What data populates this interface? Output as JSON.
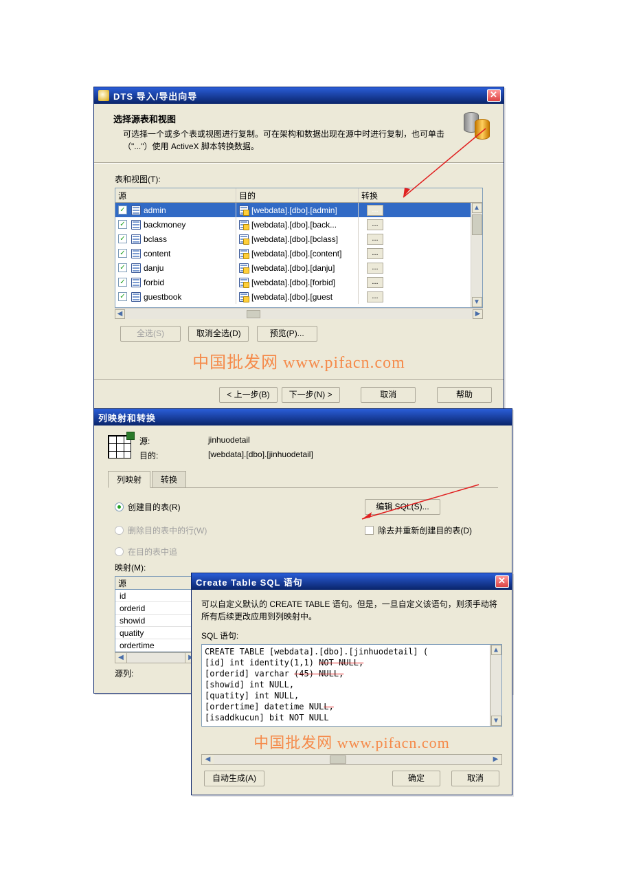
{
  "dts": {
    "title": "DTS 导入/导出向导",
    "header": {
      "heading": "选择源表和视图",
      "sub": "可选择一个或多个表或视图进行复制。可在架构和数据出现在源中时进行复制，也可单击（\"...\"）使用 ActiveX 脚本转换数据。"
    },
    "list_label": "表和视图(T):",
    "columns": {
      "source": "源",
      "dest": "目的",
      "transform": "转换"
    },
    "rows": [
      {
        "checked": true,
        "source": "admin",
        "dest": "[webdata].[dbo].[admin]",
        "selected": true
      },
      {
        "checked": true,
        "source": "backmoney",
        "dest": "[webdata].[dbo].[back...",
        "selected": false
      },
      {
        "checked": true,
        "source": "bclass",
        "dest": "[webdata].[dbo].[bclass]",
        "selected": false
      },
      {
        "checked": true,
        "source": "content",
        "dest": "[webdata].[dbo].[content]",
        "selected": false
      },
      {
        "checked": true,
        "source": "danju",
        "dest": "[webdata].[dbo].[danju]",
        "selected": false
      },
      {
        "checked": true,
        "source": "forbid",
        "dest": "[webdata].[dbo].[forbid]",
        "selected": false
      },
      {
        "checked": true,
        "source": "guestbook",
        "dest": "[webdata].[dbo].[guest",
        "selected": false
      }
    ],
    "buttons": {
      "select_all": "全选(S)",
      "deselect_all": "取消全选(D)",
      "preview": "预览(P)..."
    },
    "footer": {
      "back": "< 上一步(B)",
      "next": "下一步(N) >",
      "cancel": "取消",
      "help": "帮助"
    },
    "watermark": "中国批发网 www.pifacn.com"
  },
  "mapping": {
    "title": "列映射和转换",
    "source_label": "源:",
    "source_value": "jinhuodetail",
    "dest_label": "目的:",
    "dest_value": "[webdata].[dbo].[jinhuodetail]",
    "tabs": {
      "map": "列映射",
      "transform": "转换"
    },
    "radio_create": "创建目的表(R)",
    "edit_sql": "编辑 SQL(S)...",
    "radio_delete": "删除目的表中的行(W)",
    "chk_drop": "除去并重新创建目的表(D)",
    "radio_append": "在目的表中追",
    "map_label": "映射(M):",
    "map_header": "源",
    "map_cols": [
      "id",
      "orderid",
      "showid",
      "quatity",
      "ordertime"
    ],
    "src_col_label": "源列:"
  },
  "sql": {
    "title": "Create Table SQL 语句",
    "help": "可以自定义默认的 CREATE TABLE 语句。但是，一旦自定义该语句，则须手动将所有后续更改应用到列映射中。",
    "label": "SQL 语句:",
    "lines": {
      "l1": "CREATE TABLE [webdata].[dbo].[jinhuodetail] (",
      "l2a": "[id] int identity(1,1) ",
      "l2b": "NOT NULL,",
      "l3a": "[orderid] varchar ",
      "l3b": "(45)",
      "l3c": " NULL,",
      "l4": "[showid] int NULL,",
      "l5": "[quatity] int NULL,",
      "l6a": "[ordertime] datetime NUL",
      "l6b": "L,",
      "l7": "[isaddkucun] bit NOT NULL"
    },
    "watermark": "中国批发网 www.pifacn.com",
    "buttons": {
      "auto": "自动生成(A)",
      "ok": "确定",
      "cancel": "取消"
    }
  }
}
